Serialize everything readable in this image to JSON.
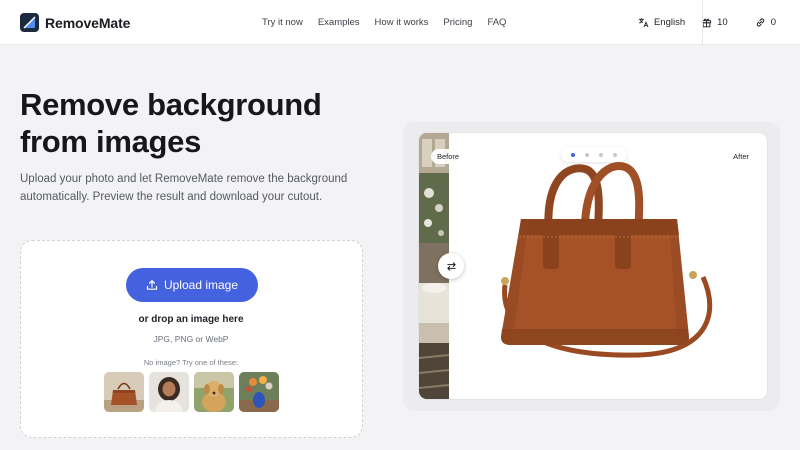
{
  "brand": {
    "name": "RemoveMate",
    "logo_icon": "removemate-logo-icon"
  },
  "nav": {
    "items": [
      {
        "label": "Try it now"
      },
      {
        "label": "Examples"
      },
      {
        "label": "How it works"
      },
      {
        "label": "Pricing"
      },
      {
        "label": "FAQ"
      }
    ]
  },
  "header_right": {
    "language": {
      "label": "English",
      "icon": "translate-icon"
    },
    "credits": {
      "value": "10",
      "icon": "gift-icon"
    },
    "links": {
      "value": "0",
      "icon": "link-icon"
    }
  },
  "hero": {
    "title_line1": "Remove background",
    "title_line2": "from images",
    "subtitle": "Upload your photo and let RemoveMate remove the background automatically. Preview the result and download your cutout."
  },
  "upload": {
    "button_label": "Upload image",
    "button_icon": "upload-icon",
    "drop_text": "or drop an image here",
    "formats": "JPG, PNG or WebP",
    "try_text": "No image? Try one of these:",
    "samples": [
      "sample-handbag",
      "sample-woman-portrait",
      "sample-dog",
      "sample-vase-flowers"
    ]
  },
  "preview": {
    "before_label": "Before",
    "after_label": "After",
    "slides_count": 4,
    "active_slide": 1,
    "compare_handle_icon": "swap-arrows-icon"
  },
  "colors": {
    "accent": "#4461e0",
    "background": "#f3f3f5",
    "bag_leather": "#a65228",
    "text_primary": "#15171c"
  }
}
